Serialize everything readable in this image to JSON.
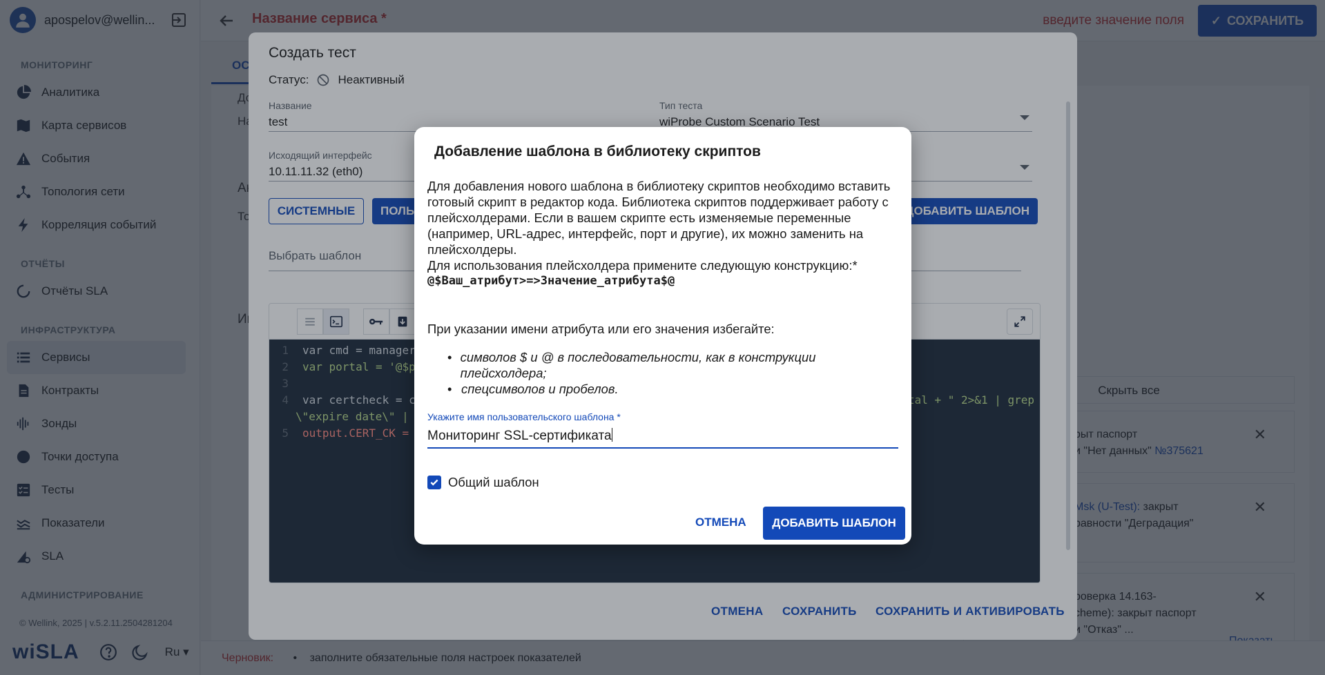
{
  "sidebar": {
    "user": "apospelov@wellin...",
    "sections": {
      "monitoring": "МОНИТОРИНГ",
      "reports": "ОТЧЁТЫ",
      "infrastructure": "ИНФРАСТРУКТУРА",
      "admin": "АДМИНИСТРИРОВАНИЕ"
    },
    "items": {
      "analytics": "Аналитика",
      "services_map": "Карта сервисов",
      "events": "События",
      "topology": "Топология сети",
      "correlation": "Корреляция событий",
      "sla_reports": "Отчёты SLA",
      "services": "Сервисы",
      "contracts": "Контракты",
      "probes": "Зонды",
      "access_points": "Точки доступа",
      "tests": "Тесты",
      "indicators": "Показатели",
      "sla": "SLA"
    },
    "copyright": "© Wellink, 2025 | v.5.2.11.2504281204",
    "logo": "wiSLA",
    "language": "Ru"
  },
  "page": {
    "title": "Название сервиса *",
    "field_error": "введите значение поля",
    "save_label": "СОХРАНИТЬ",
    "tab_label": "ОС",
    "bg_letters": [
      "До",
      "На",
      "Ак",
      "То",
      "Ин"
    ],
    "hide_all": "Скрыть все",
    "show": "Показать",
    "notifications": [
      {
        "line1": "рыт паспорт",
        "line2": "и \"Нет данных\" ",
        "link": "№375621"
      },
      {
        "line1_link": "Msk (U-Test):",
        "line1": " закрыт",
        "line2": "равности \"Деградация\""
      },
      {
        "line1": "роверка 14.163-",
        "line2": "cheme): закрыт паспорт",
        "line3": "и \"Отказ\" ..."
      }
    ],
    "footer_label": "Черновик:",
    "footer_text": "заполните обязательные поля настроек показателей"
  },
  "create_test": {
    "title": "Создать тест",
    "status_label": "Статус:",
    "status_value": "Неактивный",
    "name_label": "Название",
    "name_value": "test",
    "type_label": "Тип теста",
    "type_value": "wiProbe Custom Scenario Test",
    "iface_label": "Исходящий интерфейс",
    "iface_value": "10.11.11.32 (eth0)",
    "btn_system": "СИСТЕМНЫЕ",
    "btn_user": "ПОЛЬ",
    "btn_add_template": "ДОБАВИТЬ ШАБЛОН",
    "template_placeholder": "Выбрать шаблон",
    "code": {
      "l1": "var cmd = manager.",
      "l2": "var portal = '@$po",
      "l4a": "var certcheck = cm",
      "l4b": "rtal + \" 2>&1 | grep",
      "l4c": "\\\"expire date\\\" | a",
      "l5": "output.CERT_CK = c"
    },
    "footer_cancel": "ОТМЕНА",
    "footer_save": "СОХРАНИТЬ",
    "footer_save_activate": "СОХРАНИТЬ И АКТИВИРОВАТЬ"
  },
  "dialog": {
    "title": "Добавление шаблона в библиотеку скриптов",
    "para1": "Для добавления нового шаблона в библиотеку скриптов необходимо вставить готовый скрипт в редактор кода. Библиотека скриптов поддерживает работу с плейсхолдерами. Если в вашем скрипте есть изменяемые переменные (например, URL-адрес, интерфейс, порт и другие), их можно заменить на плейсхолдеры.",
    "para2": "Для использования плейсхолдера примените следующую конструкцию:*",
    "construct": "@$Ваш_атрибут>=>Значение_атрибута$@",
    "avoid": "При указании имени атрибута или его значения избегайте:",
    "list": [
      "символов $ и @ в последовательности, как в конструкции плейсхолдера;",
      "спецсимволов и пробелов."
    ],
    "field_label": "Укажите имя пользовательского шаблона *",
    "field_value": "Мониторинг SSL-сертификата",
    "checkbox_label": "Общий шаблон",
    "checkbox_checked": true,
    "cancel": "ОТМЕНА",
    "add": "ДОБАВИТЬ ШАБЛОН"
  },
  "colors": {
    "primary": "#1349b8",
    "error": "#c62828",
    "code_bg": "#1e2a3a"
  }
}
